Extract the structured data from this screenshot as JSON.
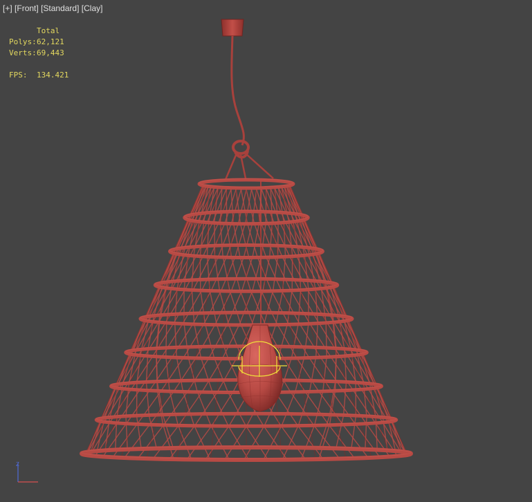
{
  "viewport": {
    "labels": {
      "plus": "[+]",
      "view": "[Front]",
      "shading": "[Standard]",
      "style": "[Clay]"
    },
    "stats": {
      "header": "Total",
      "polys_label": "Polys:",
      "polys_value": "62,121",
      "verts_label": "Verts:",
      "verts_value": "69,443",
      "fps_label": "FPS:",
      "fps_value": "134.421"
    },
    "colors": {
      "background": "#444444",
      "stats_text": "#e3d85f",
      "clay": "#b84a44",
      "clay_dark": "#7e2a27",
      "gizmo": "#f2e23a"
    },
    "object": "wicker-pendant-lamp",
    "axis_gizmo": [
      "z-axis",
      "x-axis"
    ]
  }
}
